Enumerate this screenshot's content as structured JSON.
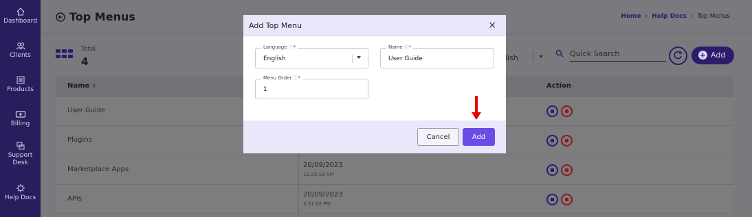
{
  "sidebar": {
    "items": [
      {
        "label": "Dashboard",
        "icon": "home-icon"
      },
      {
        "label": "Clients",
        "icon": "users-icon"
      },
      {
        "label": "Products",
        "icon": "products-icon"
      },
      {
        "label": "Billing",
        "icon": "billing-icon"
      },
      {
        "label": "Support Desk",
        "icon": "support-icon"
      },
      {
        "label": "Help Docs",
        "icon": "help-docs-icon"
      }
    ]
  },
  "header": {
    "title": "Top Menus",
    "breadcrumb": [
      "Home",
      "Help Docs",
      "Top Menus"
    ]
  },
  "summary": {
    "total_label": "Total",
    "total_value": "4"
  },
  "toolbar": {
    "language_partial": "lish",
    "search_placeholder": "Quick Search",
    "add_label": "Add"
  },
  "table": {
    "columns": [
      "Name",
      "Action"
    ],
    "rows": [
      {
        "name": "User Guide",
        "date": "",
        "time": ""
      },
      {
        "name": "Plugins",
        "date": "",
        "time": ""
      },
      {
        "name": "Marketplace Apps",
        "date": "20/09/2023",
        "time": "11:20:18 AM"
      },
      {
        "name": "APIs",
        "date": "20/09/2023",
        "time": "3:31:02 PM"
      }
    ]
  },
  "modal": {
    "title": "Add Top Menu",
    "close_glyph": "×",
    "language_label": "Language",
    "language_value": "English",
    "name_label": "Name",
    "name_value": "User Guide",
    "order_label": "Menu Order",
    "order_value": "1",
    "cancel_label": "Cancel",
    "add_label": "Add"
  },
  "colors": {
    "sidebar": "#2a1d5e",
    "primary": "#6a4ce6",
    "annotation_arrow": "#e60000"
  }
}
